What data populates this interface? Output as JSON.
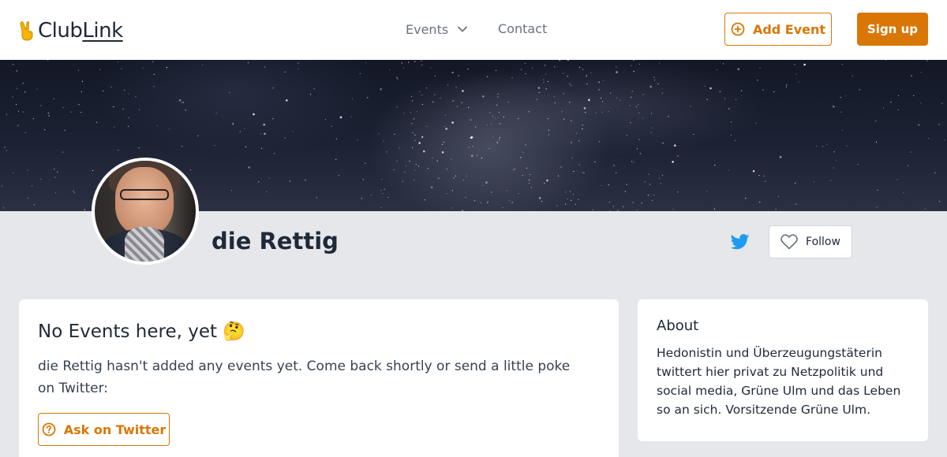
{
  "brand": {
    "logo_club": "Club",
    "logo_link": "Link",
    "accent_color": "#d97706",
    "twitter_color": "#1d9bf0"
  },
  "header": {
    "nav_events": "Events",
    "nav_contact": "Contact",
    "add_event_label": "Add Event",
    "sign_up_label": "Sign up"
  },
  "profile": {
    "name": "die Rettig",
    "follow_label": "Follow"
  },
  "events_card": {
    "title": "No Events here, yet 🤔",
    "message": "die Rettig hasn't added any events yet. Come back shortly or send a little poke on Twitter:",
    "ask_label": "Ask on Twitter"
  },
  "about_card": {
    "title": "About",
    "bio": "Hedonistin und Überzeugungstäterin twittert hier privat zu Netzpolitik und social media, Grüne Ulm und das Leben so an sich. Vorsitzende Grüne Ulm."
  }
}
